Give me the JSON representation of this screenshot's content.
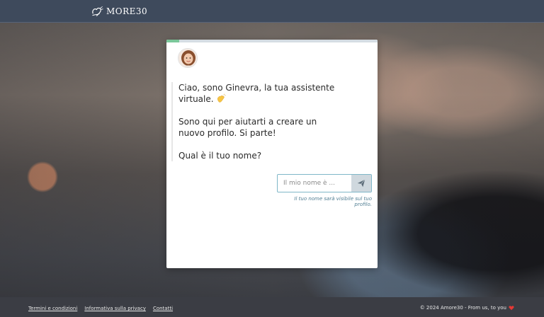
{
  "header": {
    "logo_text": "MORE30"
  },
  "chat": {
    "progress_percent": 6,
    "messages": [
      "Ciao, sono Ginevra, la tua assistente virtuale.",
      "Sono qui per aiutarti a creare un nuovo profilo. Si parte!",
      "Qual è il tuo nome?"
    ],
    "input": {
      "placeholder": "Il mio nome è ...",
      "value": ""
    },
    "hint": "Il tuo nome sarà visibile sul tuo profilo."
  },
  "footer": {
    "links": [
      "Termini e condizioni",
      "Informativa sulla privacy",
      "Contatti"
    ],
    "copyright": "© 2024 Amore30 - From us, to you"
  },
  "colors": {
    "header_bg": "#3e4a5c",
    "progress": "#7bc79a",
    "input_border": "#7fb7c8",
    "hint": "#4f7d92",
    "heart": "#e53935"
  },
  "icons": {
    "logo": "heart-ribbon-icon",
    "wave": "waving-hand-icon",
    "send": "paper-plane-icon",
    "heart": "heart-icon"
  }
}
